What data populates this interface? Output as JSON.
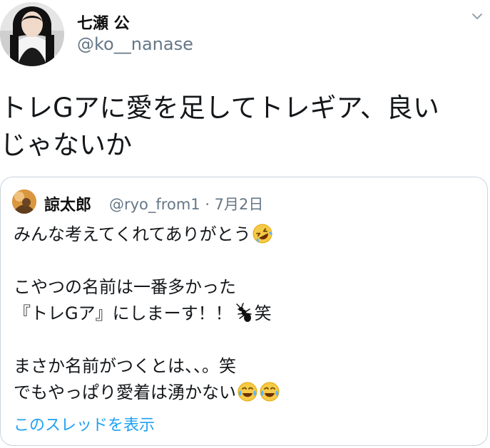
{
  "tweet": {
    "author": {
      "display_name": "七瀬 公",
      "handle": "@ko__nanase",
      "avatar_icon": "profile-photo"
    },
    "menu_icon": "chevron-down-icon",
    "text_lines": [
      "トレGアに愛を足してトレギア、良い",
      "じゃないか"
    ]
  },
  "quoted_tweet": {
    "author": {
      "display_name": "諒太郎",
      "meta": "@ryo_from1 · 7月2日",
      "avatar_icon": "profile-photo"
    },
    "lines": [
      "みんな考えてくれてありがとう",
      "",
      "こやつの名前は一番多かった",
      "『トレGア』にしまーす！！",
      "笑",
      "",
      "まさか名前がつくとは、、。笑",
      "でもやっぱり愛着は湧かない"
    ],
    "emoji": {
      "line1": "rolling-on-floor-laughing-emoji",
      "line4": "ant-emoji",
      "line8": [
        "tears-of-joy-emoji",
        "tears-of-joy-emoji"
      ]
    },
    "show_thread_label": "このスレッドを表示"
  },
  "colors": {
    "text": "#14171a",
    "secondary_text": "#657786",
    "link": "#1da1f2",
    "border": "#c9d3dc",
    "emoji_yellow": "#f7c948"
  }
}
